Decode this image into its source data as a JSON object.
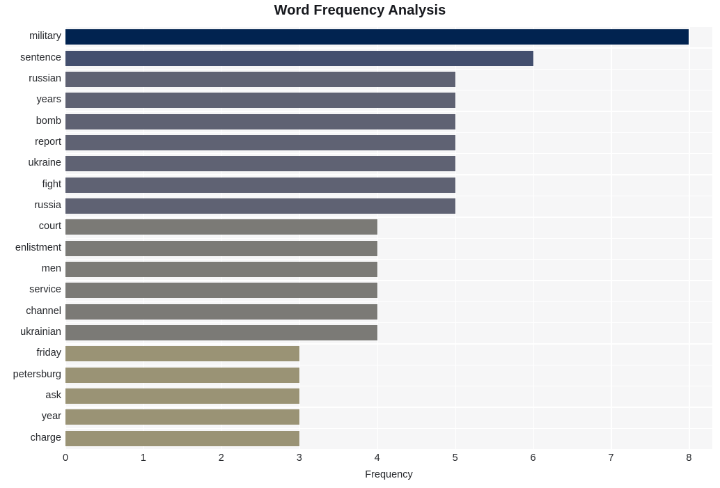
{
  "chart_data": {
    "type": "bar",
    "orientation": "horizontal",
    "title": "Word Frequency Analysis",
    "xlabel": "Frequency",
    "ylabel": "",
    "xlim": [
      0,
      8.3
    ],
    "xticks": [
      0,
      1,
      2,
      3,
      4,
      5,
      6,
      7,
      8
    ],
    "xtick_labels": [
      "0",
      "1",
      "2",
      "3",
      "4",
      "5",
      "6",
      "7",
      "8"
    ],
    "grid": true,
    "legend": null,
    "categories": [
      "military",
      "sentence",
      "russian",
      "years",
      "bomb",
      "report",
      "ukraine",
      "fight",
      "russia",
      "court",
      "enlistment",
      "men",
      "service",
      "channel",
      "ukrainian",
      "friday",
      "petersburg",
      "ask",
      "year",
      "charge"
    ],
    "values": [
      8,
      6,
      5,
      5,
      5,
      5,
      5,
      5,
      5,
      4,
      4,
      4,
      4,
      4,
      4,
      3,
      3,
      3,
      3,
      3
    ],
    "bar_colors": [
      "#012350",
      "#434f6e",
      "#5f6273",
      "#5f6273",
      "#5f6273",
      "#5f6273",
      "#5f6273",
      "#5f6273",
      "#5f6273",
      "#7b7a76",
      "#7b7a76",
      "#7b7a76",
      "#7b7a76",
      "#7b7a76",
      "#7b7a76",
      "#9a9375",
      "#9a9375",
      "#9a9375",
      "#9a9375",
      "#9a9375"
    ],
    "plot_background": "#f6f6f7",
    "gridline_color": "#ffffff",
    "figure_background": "#ffffff",
    "title_color": "#16181d",
    "tick_color": "#26282c"
  }
}
